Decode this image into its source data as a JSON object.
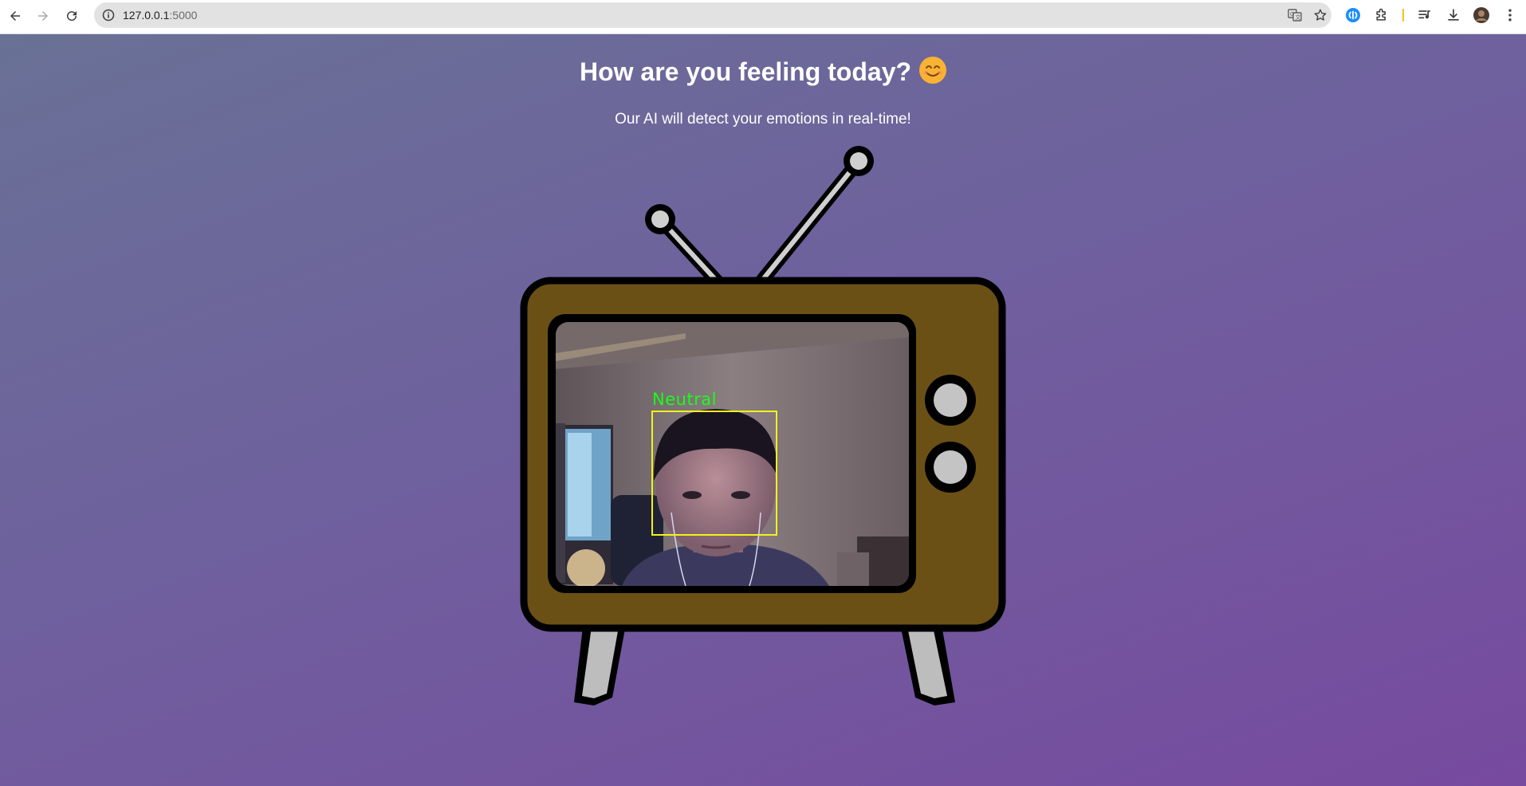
{
  "browser": {
    "url_host": "127.0.0.1",
    "url_port": ":5000",
    "icons": {
      "back": "arrow-left-icon",
      "forward": "arrow-right-icon",
      "reload": "reload-icon",
      "site_info": "info-icon",
      "translate": "translate-icon",
      "bookmark": "star-icon",
      "shazam": "shazam-icon",
      "extensions": "puzzle-icon",
      "media": "media-playlist-icon",
      "downloads": "download-icon",
      "profile": "avatar-icon",
      "menu": "kebab-menu-icon"
    }
  },
  "page": {
    "title": "How are you feeling today?",
    "title_emoji": "smiling-face-emoji",
    "subtitle": "Our AI will detect your emotions in real-time!",
    "video": {
      "emotion_label": "Neutral",
      "label_color": "#18ff18",
      "box_color": "#f2f21a"
    },
    "colors": {
      "tv_body": "#6b5016",
      "knob": "#c4c4c4",
      "gradient_start": "#697196",
      "gradient_end": "#774a9f"
    }
  }
}
